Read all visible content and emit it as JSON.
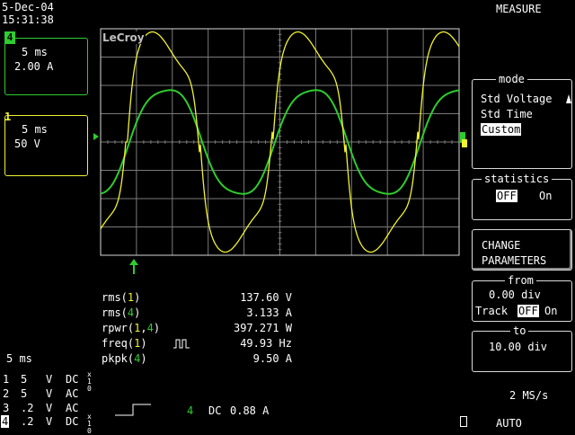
{
  "header": {
    "date": "5-Dec-04",
    "time": "15:31:38",
    "panel_title": "MEASURE"
  },
  "logo": "LeCroy",
  "channel_boxes": [
    {
      "id": "4",
      "timebase": "5 ms",
      "scale": "2.00 A",
      "color": "#2ecc2e"
    },
    {
      "id": "1",
      "timebase": "5 ms",
      "scale": "50 V",
      "color": "#f2f230"
    }
  ],
  "menu": {
    "mode": {
      "title": "mode",
      "options": [
        "Std Voltage",
        "Std Time",
        "Custom"
      ],
      "selected": "Custom"
    },
    "statistics": {
      "title": "statistics",
      "off": "OFF",
      "on": "On",
      "selected": "OFF"
    },
    "change_parameters": {
      "line1": "CHANGE",
      "line2": "PARAMETERS"
    },
    "from": {
      "title": "from",
      "value": "0.00 div",
      "track_label": "Track",
      "off": "OFF",
      "on": "On"
    },
    "to": {
      "title": "to",
      "value": "10.00 div"
    }
  },
  "measurements": [
    {
      "name": "rms(",
      "ch": "1",
      "close": ")",
      "value": "137.60 V"
    },
    {
      "name": "rms(",
      "ch": "4",
      "close": ")",
      "value": "3.133 A"
    },
    {
      "name": "rpwr(",
      "ch": "1,4",
      "close": ")",
      "value": "397.271 W"
    },
    {
      "name": "freq(",
      "ch": "1",
      "close": ")",
      "value": "49.93 Hz"
    },
    {
      "name": "pkpk(",
      "ch": "4",
      "close": ")",
      "value": "9.50 A"
    }
  ],
  "timebase_label": "5 ms",
  "channels": [
    {
      "num": "1",
      "volts": "5",
      "unit": "V",
      "coupling": "DC",
      "probe": "x10"
    },
    {
      "num": "2",
      "volts": "5",
      "unit": "V",
      "coupling": "AC",
      "probe": ""
    },
    {
      "num": "3",
      "volts": ".2",
      "unit": "V",
      "coupling": "AC",
      "probe": ""
    },
    {
      "num": "4",
      "volts": ".2",
      "unit": "V",
      "coupling": "DC",
      "probe": "x10"
    }
  ],
  "trigger": {
    "channel": "4",
    "coupling": "DC",
    "level": "0.88 A"
  },
  "sample_rate": "2 MS/s",
  "trigger_mode": "AUTO",
  "colors": {
    "ch1": "#f2f230",
    "ch4": "#2ecc2e",
    "grid": "#7a7a7a",
    "frame": "#d9d9d9"
  }
}
